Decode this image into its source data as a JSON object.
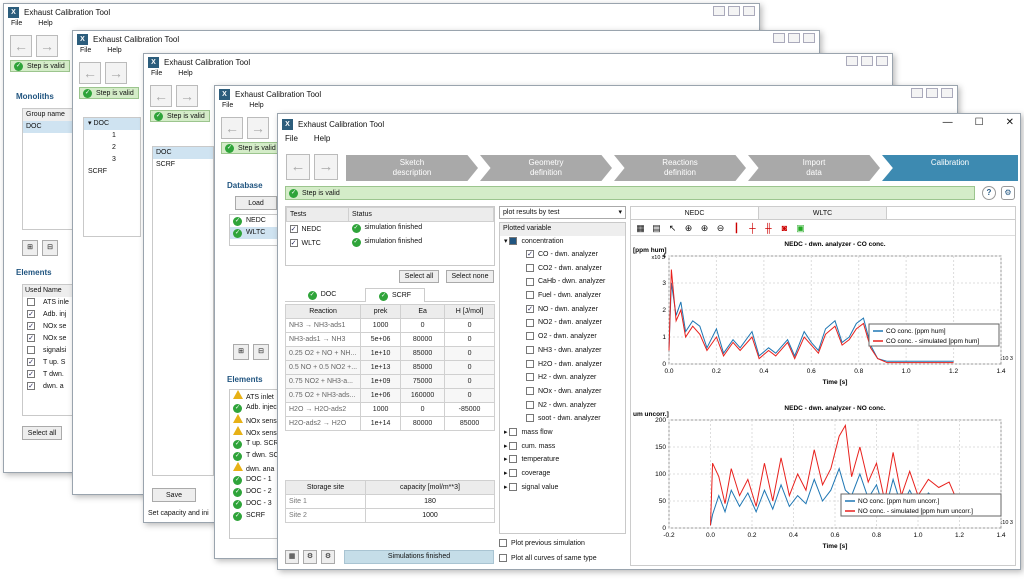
{
  "app_title": "Exhaust Calibration Tool",
  "menu": {
    "file": "File",
    "help": "Help"
  },
  "step_valid": "Step is valid",
  "win1": {
    "monoliths_label": "Monoliths",
    "group_header": "Group name",
    "group_row": "DOC",
    "elements_label": "Elements",
    "cols": [
      "Used",
      "Name"
    ],
    "items": [
      {
        "checked": false,
        "name": "ATS inle"
      },
      {
        "checked": true,
        "name": "Adb. inj"
      },
      {
        "checked": true,
        "name": "NOx se"
      },
      {
        "checked": true,
        "name": "NOx se"
      },
      {
        "checked": false,
        "name": "signalsi"
      },
      {
        "checked": true,
        "name": "T up. S"
      },
      {
        "checked": true,
        "name": "T dwn."
      },
      {
        "checked": true,
        "name": "dwn. a"
      }
    ],
    "select_all": "Select all"
  },
  "win2": {
    "tree": [
      {
        "label": "DOC",
        "indent": 0
      },
      {
        "label": "1",
        "indent": 2
      },
      {
        "label": "2",
        "indent": 2
      },
      {
        "label": "3",
        "indent": 2
      },
      {
        "label": "SCRF",
        "indent": 0
      }
    ]
  },
  "win3": {
    "list": [
      "DOC",
      "SCRF"
    ],
    "save": "Save",
    "status": "Set capacity and ini"
  },
  "win4": {
    "database_label": "Database",
    "load": "Load",
    "tests": [
      "NEDC",
      "WLTC"
    ],
    "elements_label": "Elements",
    "elements": [
      {
        "icon": "warn",
        "label": "ATS inlet"
      },
      {
        "icon": "ok",
        "label": "Adb. injec"
      },
      {
        "icon": "warn",
        "label": "NOx sens"
      },
      {
        "icon": "warn",
        "label": "NOx sens"
      },
      {
        "icon": "ok",
        "label": "T up. SCR"
      },
      {
        "icon": "ok",
        "label": "T dwn. SC"
      },
      {
        "icon": "warn",
        "label": "dwn. ana"
      },
      {
        "icon": "ok",
        "label": "DOC - 1"
      },
      {
        "icon": "ok",
        "label": "DOC - 2"
      },
      {
        "icon": "ok",
        "label": "DOC - 3"
      },
      {
        "icon": "ok",
        "label": "SCRF"
      }
    ]
  },
  "steps": [
    {
      "label": "Sketch\ndescription"
    },
    {
      "label": "Geometry\ndefinition"
    },
    {
      "label": "Reactions\ndefinition"
    },
    {
      "label": "Import\ndata"
    },
    {
      "label": "Calibration"
    }
  ],
  "tests_table": {
    "headers": [
      "Tests",
      "Status"
    ],
    "rows": [
      {
        "name": "NEDC",
        "status": "simulation finished"
      },
      {
        "name": "WLTC",
        "status": "simulation finished"
      }
    ]
  },
  "buttons": {
    "select_all": "Select all",
    "select_none": "Select none",
    "simulations_finished": "Simulations finished"
  },
  "tabs": [
    "DOC",
    "SCRF"
  ],
  "reactions": {
    "headers": [
      "Reaction",
      "prek",
      "Ea",
      "H [J/mol]"
    ],
    "rows": [
      {
        "reaction": "NH3  →  NH3-ads1",
        "prek": "1000",
        "ea": "0",
        "h": "0"
      },
      {
        "reaction": "NH3-ads1  →  NH3",
        "prek": "5e+06",
        "ea": "80000",
        "h": "0"
      },
      {
        "reaction": "0.25 O2 + NO + NH...",
        "prek": "1e+10",
        "ea": "85000",
        "h": "0"
      },
      {
        "reaction": "0.5 NO + 0.5 NO2 +...",
        "prek": "1e+13",
        "ea": "85000",
        "h": "0"
      },
      {
        "reaction": "0.75 NO2 + NH3-a...",
        "prek": "1e+09",
        "ea": "75000",
        "h": "0"
      },
      {
        "reaction": "0.75 O2 + NH3-ads...",
        "prek": "1e+06",
        "ea": "160000",
        "h": "0"
      },
      {
        "reaction": "H2O  →  H2O-ads2",
        "prek": "1000",
        "ea": "0",
        "h": "-85000"
      },
      {
        "reaction": "H2O-ads2  →  H2O",
        "prek": "1e+14",
        "ea": "80000",
        "h": "85000"
      }
    ]
  },
  "storage": {
    "headers": [
      "Storage site",
      "capacity [mol/m**3]"
    ],
    "rows": [
      {
        "site": "Site 1",
        "cap": "180"
      },
      {
        "site": "Site 2",
        "cap": "1000"
      }
    ]
  },
  "plot_select": "plot results by test",
  "plotted_header": "Plotted variable",
  "concentration_label": "concentration",
  "conc_items": [
    {
      "label": "CO - dwn. analyzer",
      "checked": true
    },
    {
      "label": "CO2 - dwn. analyzer",
      "checked": false
    },
    {
      "label": "CaHb - dwn. analyzer",
      "checked": false
    },
    {
      "label": "Fuel - dwn. analyzer",
      "checked": false
    },
    {
      "label": "NO - dwn. analyzer",
      "checked": true
    },
    {
      "label": "NO2 - dwn. analyzer",
      "checked": false
    },
    {
      "label": "O2 - dwn. analyzer",
      "checked": false
    },
    {
      "label": "NH3 - dwn. analyzer",
      "checked": false
    },
    {
      "label": "H2O - dwn. analyzer",
      "checked": false
    },
    {
      "label": "H2 - dwn. analyzer",
      "checked": false
    },
    {
      "label": "NOx - dwn. analyzer",
      "checked": false
    },
    {
      "label": "N2 - dwn. analyzer",
      "checked": false
    },
    {
      "label": "soot - dwn. analyzer",
      "checked": false
    }
  ],
  "groups": [
    "mass flow",
    "cum. mass",
    "temperature",
    "coverage",
    "signal value"
  ],
  "bottom_checks": [
    "Plot previous simulation",
    "Plot all curves of same type"
  ],
  "plot_tabs": [
    "NEDC",
    "WLTC"
  ],
  "chart_data": [
    {
      "type": "line",
      "title": "NEDC - dwn. analyzer - CO conc.",
      "ylabel": "[ppm hum]",
      "y_exp": "x10 3",
      "x_exp": "x10 3",
      "xlabel": "Time [s]",
      "xlim": [
        0,
        1.4
      ],
      "ylim": [
        0,
        4
      ],
      "xticks": [
        "0.0",
        "0.2",
        "0.4",
        "0.6",
        "0.8",
        "1.0",
        "1.2",
        "1.4"
      ],
      "yticks": [
        "0",
        "1",
        "2",
        "3",
        "4"
      ],
      "x": [
        0,
        0.01,
        0.03,
        0.05,
        0.07,
        0.1,
        0.13,
        0.16,
        0.2,
        0.23,
        0.27,
        0.3,
        0.35,
        0.38,
        0.42,
        0.45,
        0.5,
        0.53,
        0.57,
        0.6,
        0.63,
        0.66,
        0.7,
        0.73,
        0.76,
        0.79,
        0.82,
        0.85,
        0.88,
        0.92,
        1.0,
        1.1,
        1.2
      ],
      "series": [
        {
          "name": "CO conc. [ppm hum]",
          "color": "#1f77b4",
          "values": [
            0.6,
            3.0,
            1.8,
            2.3,
            1.2,
            1.6,
            1.4,
            0.6,
            1.3,
            0.4,
            0.9,
            0.6,
            1.2,
            0.3,
            0.6,
            0.4,
            0.9,
            0.3,
            1.2,
            0.8,
            0.5,
            1.3,
            1.6,
            0.8,
            1.0,
            1.5,
            1.7,
            0.7,
            0.2,
            0.1,
            0.1,
            0.1,
            0.1
          ]
        },
        {
          "name": "CO conc. - simulated [ppm hum]",
          "color": "#e8211d",
          "values": [
            0.5,
            3.5,
            1.6,
            2.0,
            1.0,
            1.4,
            1.1,
            0.5,
            1.0,
            0.3,
            0.8,
            0.5,
            1.0,
            0.2,
            0.5,
            0.3,
            0.8,
            0.2,
            1.0,
            0.7,
            0.4,
            1.1,
            1.4,
            0.7,
            0.9,
            1.3,
            1.5,
            0.6,
            0.2,
            0.05,
            0.05,
            0.05,
            0.05
          ]
        }
      ]
    },
    {
      "type": "line",
      "title": "NEDC - dwn. analyzer - NO conc.",
      "ylabel": "um uncorr.]",
      "xlabel": "Time [s]",
      "x_exp": "x10 3",
      "xlim": [
        -0.2,
        1.4
      ],
      "ylim": [
        0,
        200
      ],
      "xticks": [
        "-0.2",
        "0.0",
        "0.2",
        "0.4",
        "0.6",
        "0.8",
        "1.0",
        "1.2",
        "1.4"
      ],
      "yticks": [
        "0",
        "50",
        "100",
        "150",
        "200"
      ],
      "x": [
        0.0,
        0.01,
        0.04,
        0.07,
        0.1,
        0.14,
        0.18,
        0.22,
        0.26,
        0.3,
        0.34,
        0.38,
        0.42,
        0.46,
        0.5,
        0.54,
        0.58,
        0.62,
        0.65,
        0.68,
        0.72,
        0.76,
        0.8,
        0.84,
        0.88,
        0.92,
        0.96,
        1.0,
        1.05,
        1.1,
        1.15,
        1.2
      ],
      "series": [
        {
          "name": "NO conc. [ppm hum uncorr.]",
          "color": "#1f77b4",
          "values": [
            5,
            25,
            60,
            30,
            70,
            40,
            65,
            30,
            70,
            35,
            80,
            40,
            60,
            45,
            90,
            50,
            70,
            110,
            70,
            60,
            100,
            55,
            80,
            30,
            90,
            40,
            70,
            40,
            65,
            50,
            60,
            30
          ]
        },
        {
          "name": "NO conc. - simulated [ppm hum uncorr.]",
          "color": "#e8211d",
          "values": [
            5,
            120,
            95,
            45,
            110,
            60,
            90,
            40,
            120,
            50,
            130,
            60,
            100,
            70,
            145,
            80,
            110,
            170,
            190,
            95,
            150,
            85,
            120,
            50,
            140,
            60,
            105,
            60,
            90,
            75,
            85,
            40
          ]
        }
      ]
    }
  ]
}
